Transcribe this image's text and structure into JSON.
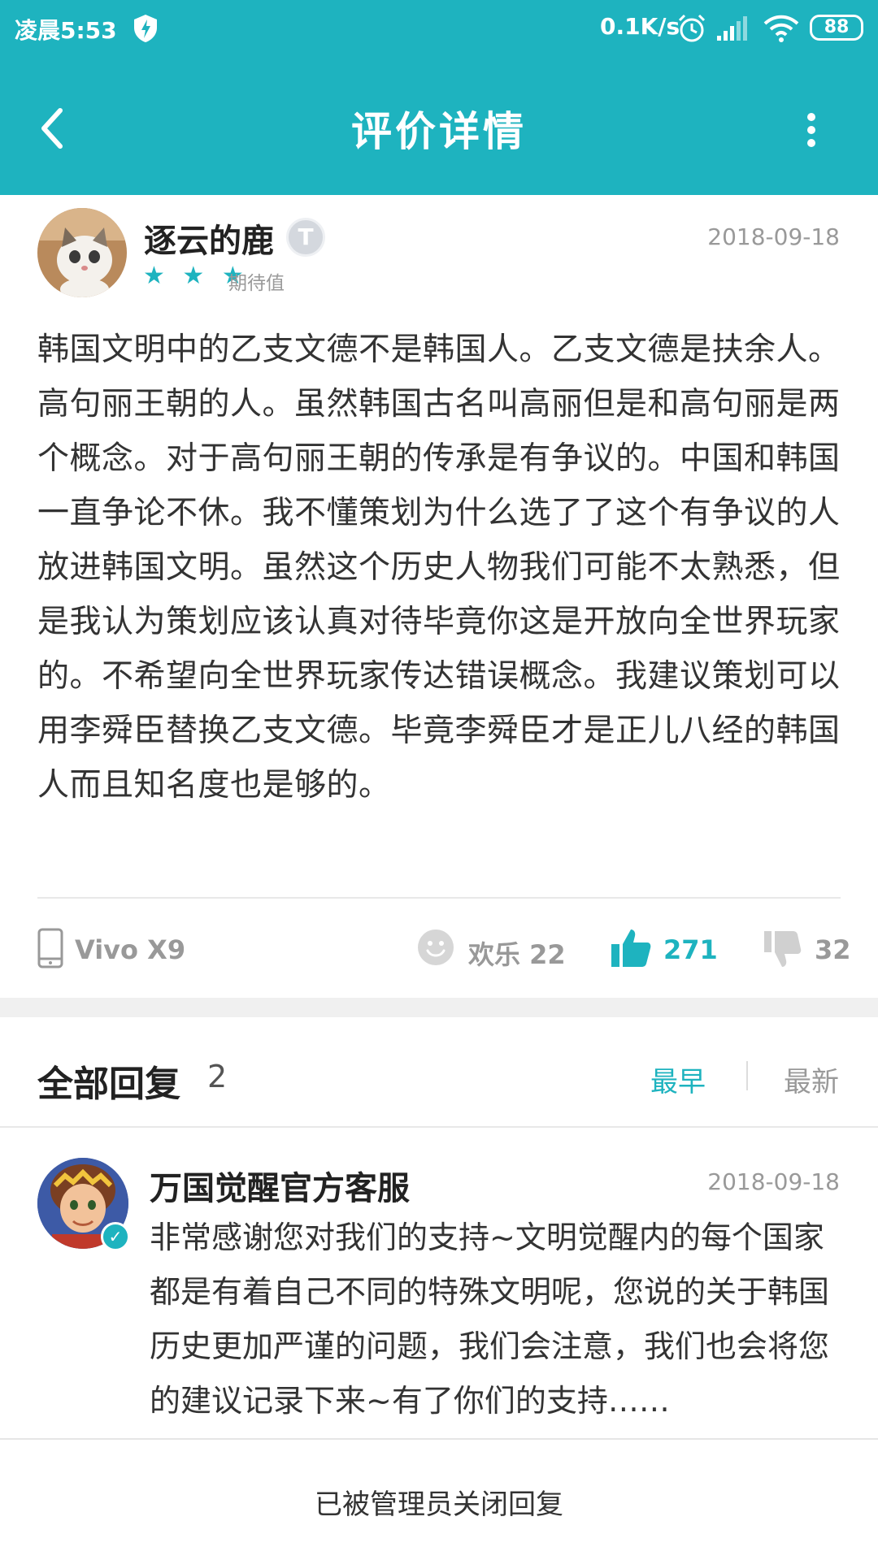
{
  "status_bar": {
    "time": "凌晨5:53",
    "network_speed": "0.1K/s",
    "battery": "88"
  },
  "header": {
    "title": "评价详情",
    "back_icon": "chevron-left-icon",
    "more_icon": "more-vertical-icon"
  },
  "review": {
    "username": "逐云的鹿",
    "badge": "T",
    "rating": 3,
    "stars_text": "★ ★ ★",
    "rating_label": "期待值",
    "date": "2018-09-18",
    "content": "韩国文明中的乙支文德不是韩国人。乙支文德是扶余人。高句丽王朝的人。虽然韩国古名叫高丽但是和高句丽是两个概念。对于高句丽王朝的传承是有争议的。中国和韩国一直争论不休。我不懂策划为什么选了了这个有争议的人放进韩国文明。虽然这个历史人物我们可能不太熟悉，但是我认为策划应该认真对待毕竟你这是开放向全世界玩家的。不希望向全世界玩家传达错误概念。我建议策划可以用李舜臣替换乙支文德。毕竟李舜臣才是正儿八经的韩国人而且知名度也是够的。",
    "device": "Vivo X9",
    "happy_label": "欢乐 22",
    "likes": "271",
    "dislikes": "32"
  },
  "replies": {
    "title": "全部回复",
    "count": "2",
    "sort_earliest": "最早",
    "sort_newest": "最新",
    "items": [
      {
        "name": "万国觉醒官方客服",
        "date": "2018-09-18",
        "text": "非常感谢您对我们的支持~文明觉醒内的每个国家都是有着自己不同的特殊文明呢，您说的关于韩国历史更加严谨的问题，我们会注意，我们也会将您的建议记录下来~有了你们的支持……"
      }
    ]
  },
  "footer": {
    "closed_text": "已被管理员关闭回复"
  },
  "colors": {
    "accent": "#1eb3bf"
  }
}
